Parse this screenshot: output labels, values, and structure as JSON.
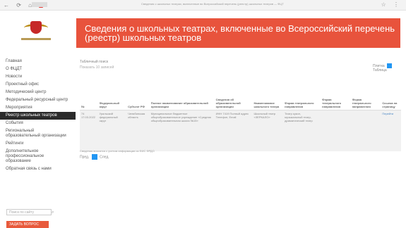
{
  "browser": {
    "nav_icons": "← ⟳ ⌂",
    "page_url_text": "Сведения о школьных театрах, включенные во Всероссийский перечень (реестр) школьных театров — ФЦТ",
    "right_icons": "☆ ⋮"
  },
  "sidebar": {
    "items": [
      "Главная",
      "О ФЦДТ",
      "Новости",
      "Проектный офис",
      "Методический центр",
      "Федеральный ресурсный центр",
      "Мероприятия",
      "Реестр школьных театров",
      "События",
      "Региональный образовательный организации",
      "Рейтинги",
      "Дополнительное профессиональное образование",
      "Обратная связь с нами"
    ],
    "active_index": 7,
    "search_placeholder": "Поиск по сайту",
    "red_button": "ЗАДАТЬ ВОПРОС"
  },
  "banner": {
    "title": "Сведения о школьных театрах, включенные во Всероссийский перечень (реестр) школьных театров"
  },
  "filter": {
    "label": "Табличный поиск",
    "sub": "Показать 10 записей"
  },
  "view_toggle": {
    "left": "Плитка",
    "right": "Таблица"
  },
  "table": {
    "headers": [
      "№",
      "Федеральный округ",
      "Субъект РФ",
      "Полное наименование образовательной организации",
      "Сведения об образовательной организации",
      "Наименование школьного театра",
      "Форма театрального направления",
      "Форма театрального направления",
      "Форма театрального направления",
      "Ссылка на страницу"
    ],
    "rows": [
      [
        "74 17.03.2022",
        "Уральский федеральный округ",
        "Челябинская область",
        "Муниципальное бюджетное общеобразовательное учреждение «Средняя общеобразовательная школа №15»",
        "ИНН 7419 Полный адрес Телефон, Email",
        "Школьный театр «ЗЕРКАЛО»",
        "Театр кукол, музыкальный театр, драматический театр",
        "",
        "",
        "Перейти"
      ]
    ]
  },
  "note": "Сведения вносятся с учетом информации из ФИС ФРДО",
  "pager": {
    "prev": "Пред.",
    "current": "1",
    "next": "След."
  }
}
